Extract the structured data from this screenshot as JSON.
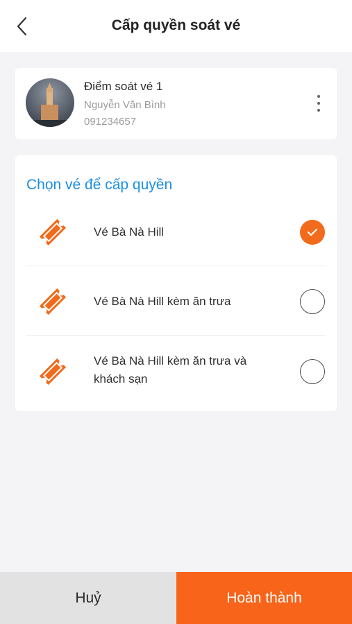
{
  "header": {
    "title": "Cấp quyền soát vé",
    "back_icon": "chevron-left-icon"
  },
  "user": {
    "role": "Điểm soát vé 1",
    "name": "Nguyễn Văn Bình",
    "phone": "091234657",
    "avatar_icon": "avatar-photo",
    "more_icon": "more-vertical-icon"
  },
  "tickets": {
    "section_title": "Chọn vé để cấp quyền",
    "items": [
      {
        "label": "Vé Bà Nà Hill",
        "selected": true
      },
      {
        "label": "Vé Bà Nà Hill kèm ăn trưa",
        "selected": false
      },
      {
        "label": "Vé Bà Nà Hill kèm ăn trưa và khách sạn",
        "selected": false
      }
    ],
    "icon": "ticket-icon"
  },
  "footer": {
    "cancel_label": "Huỷ",
    "done_label": "Hoàn thành"
  },
  "colors": {
    "accent": "#f7641a",
    "link": "#1d8fe1",
    "background": "#f4f4f6"
  }
}
